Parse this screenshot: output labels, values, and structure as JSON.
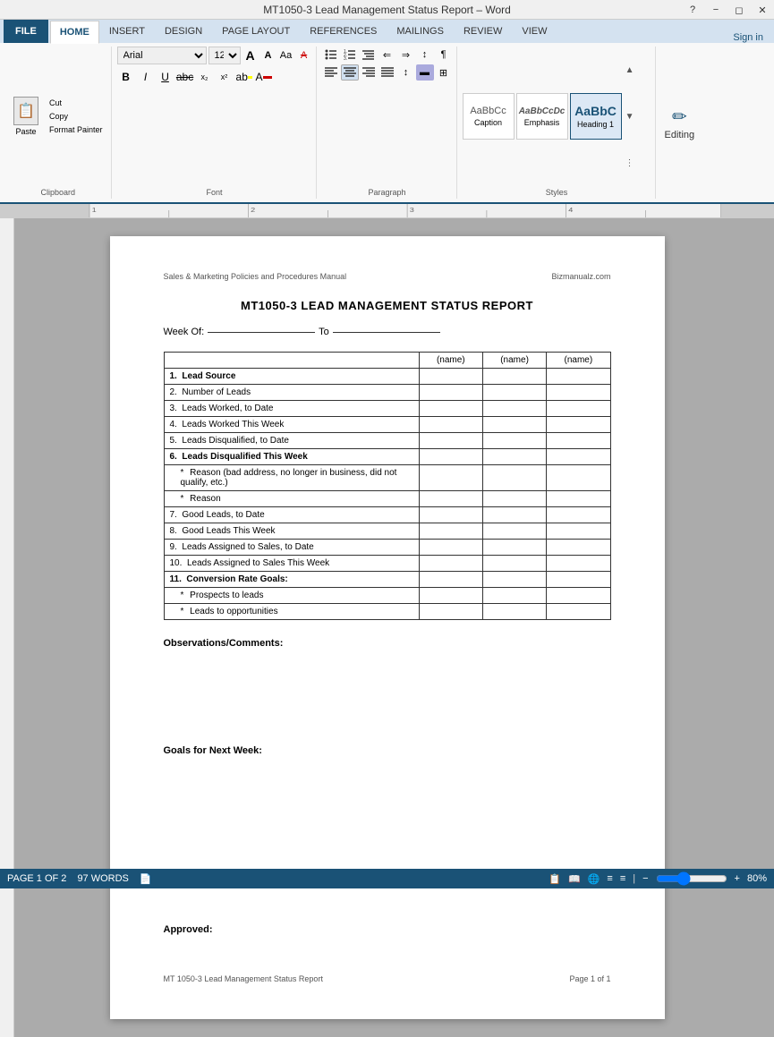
{
  "titleBar": {
    "title": "MT1050-3 Lead Management Status Report – Word",
    "controls": [
      "minimize",
      "restore",
      "close",
      "help"
    ]
  },
  "tabs": [
    {
      "label": "FILE",
      "id": "file",
      "active": false
    },
    {
      "label": "HOME",
      "id": "home",
      "active": true
    },
    {
      "label": "INSERT",
      "id": "insert",
      "active": false
    },
    {
      "label": "DESIGN",
      "id": "design",
      "active": false
    },
    {
      "label": "PAGE LAYOUT",
      "id": "page-layout",
      "active": false
    },
    {
      "label": "REFERENCES",
      "id": "references",
      "active": false
    },
    {
      "label": "MAILINGS",
      "id": "mailings",
      "active": false
    },
    {
      "label": "REVIEW",
      "id": "review",
      "active": false
    },
    {
      "label": "VIEW",
      "id": "view",
      "active": false
    }
  ],
  "ribbon": {
    "clipboard": {
      "paste_label": "Paste",
      "cut_label": "Cut",
      "copy_label": "Copy",
      "format_painter_label": "Format Painter",
      "group_label": "Clipboard"
    },
    "font": {
      "face": "Arial",
      "size": "12",
      "grow_label": "A",
      "shrink_label": "A",
      "case_label": "Aa",
      "clear_label": "A",
      "bold_label": "B",
      "italic_label": "I",
      "underline_label": "U",
      "strikethrough_label": "abc",
      "subscript_label": "x₂",
      "superscript_label": "x²",
      "highlight_label": "ab",
      "color_label": "A",
      "group_label": "Font"
    },
    "paragraph": {
      "bullets_label": "≡",
      "numbering_label": "≡",
      "multilevel_label": "≡",
      "decrease_indent_label": "⇐",
      "increase_indent_label": "⇒",
      "sort_label": "↕",
      "show_marks_label": "¶",
      "align_left_label": "≡",
      "align_center_label": "≡",
      "align_right_label": "≡",
      "justify_label": "≡",
      "line_spacing_label": "↕",
      "shading_label": "▬",
      "borders_label": "⊞",
      "group_label": "Paragraph"
    },
    "styles": {
      "items": [
        {
          "label": "Caption",
          "preview": "AaBbCc",
          "active": false
        },
        {
          "label": "Emphasis",
          "preview": "AaBbCcDc",
          "active": false
        },
        {
          "label": "Heading 1",
          "preview": "AaBbC",
          "active": true
        }
      ],
      "group_label": "Styles"
    },
    "editing": {
      "label": "Editing"
    }
  },
  "signIn": "Sign in",
  "document": {
    "header_left": "Sales & Marketing Policies and Procedures Manual",
    "header_right": "Bizmanualz.com",
    "title": "MT1050-3 LEAD MANAGEMENT STATUS REPORT",
    "week_of_label": "Week Of:",
    "to_label": "To",
    "table": {
      "headers": [
        "(name)",
        "(name)",
        "(name)"
      ],
      "rows": [
        {
          "num": "1.",
          "label": "Lead Source",
          "bold": true,
          "cells": 3
        },
        {
          "num": "2.",
          "label": "Number of Leads",
          "bold": false,
          "cells": 3
        },
        {
          "num": "3.",
          "label": "Leads Worked, to Date",
          "bold": false,
          "cells": 3
        },
        {
          "num": "4.",
          "label": "Leads Worked This Week",
          "bold": false,
          "cells": 3
        },
        {
          "num": "5.",
          "label": "Leads Disqualified, to Date",
          "bold": false,
          "cells": 3
        },
        {
          "num": "6.",
          "label": "Leads Disqualified This Week",
          "bold": true,
          "cells": 3,
          "sub_items": [
            "Reason (bad address, no longer in business, did not qualify, etc.)",
            "Reason"
          ]
        },
        {
          "num": "7.",
          "label": "Good Leads, to Date",
          "bold": false,
          "cells": 3
        },
        {
          "num": "8.",
          "label": "Good Leads This Week",
          "bold": false,
          "cells": 3
        },
        {
          "num": "9.",
          "label": "Leads Assigned to Sales, to Date",
          "bold": false,
          "cells": 3
        },
        {
          "num": "10.",
          "label": "Leads Assigned to Sales This Week",
          "bold": false,
          "cells": 3
        },
        {
          "num": "11.",
          "label": "Conversion Rate Goals:",
          "bold": true,
          "cells": 3,
          "sub_items": [
            "Prospects to leads",
            "Leads to opportunities"
          ]
        }
      ]
    },
    "observations_label": "Observations/Comments:",
    "goals_label": "Goals for Next Week:",
    "approved_label": "Approved:",
    "footer_left": "MT 1050-3 Lead Management Status Report",
    "footer_right": "Page 1 of 1"
  },
  "statusBar": {
    "page_info": "PAGE 1 OF 2",
    "words": "97 WORDS",
    "zoom_level": "80%",
    "zoom_value": 80
  }
}
